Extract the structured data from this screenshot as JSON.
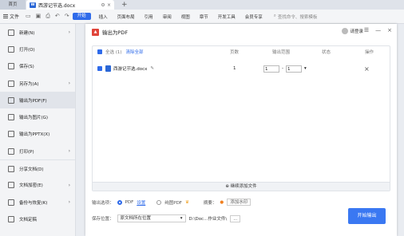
{
  "tabs": {
    "home": "首页",
    "doc_title": "西游记节选.docx",
    "doc_icon": "W"
  },
  "menu": {
    "file": "文件",
    "tabs": [
      "开始",
      "插入",
      "页面布局",
      "引用",
      "审阅",
      "视图",
      "章节",
      "开发工具",
      "会员专享"
    ],
    "search": "查找命令、搜索模板"
  },
  "sidebar": {
    "items": [
      {
        "label": "新建(N)",
        "arrow": true
      },
      {
        "label": "打开(O)",
        "arrow": false
      },
      {
        "label": "保存(S)",
        "arrow": false
      },
      {
        "label": "另存为(A)",
        "arrow": true
      },
      {
        "label": "输出为PDF(F)",
        "arrow": false,
        "active": true
      },
      {
        "label": "输出为图片(G)",
        "arrow": false
      },
      {
        "label": "输出为PPTX(X)",
        "arrow": false
      },
      {
        "label": "打印(P)",
        "arrow": true
      },
      {
        "label": "分享文档(D)",
        "arrow": false,
        "sep": true
      },
      {
        "label": "文档加密(E)",
        "arrow": true
      },
      {
        "label": "备份与恢复(K)",
        "arrow": true
      },
      {
        "label": "文档定稿",
        "arrow": false
      }
    ]
  },
  "dialog": {
    "title": "输出为PDF",
    "login": "请登录",
    "table": {
      "select_all": "全选 (1)",
      "clear": "清除全部",
      "col_pages": "页数",
      "col_range": "输出范围",
      "col_status": "状态",
      "col_action": "操作"
    },
    "file": {
      "name": "西游记节选.docx",
      "pages": "1",
      "range_from": "1",
      "range_to": "1"
    },
    "add_files": "继续添加文件",
    "output_options": "输出选项：",
    "opt_pdf": "PDF",
    "opt_settings": "设置",
    "opt_pure": "纯图PDF",
    "sort": "摘要：",
    "add_watermark": "添加水印",
    "save_location": "保存位置：",
    "save_select": "原文档所在位置",
    "save_path": "D:\\Doc...作业文件\\",
    "more": "...",
    "start": "开始输出"
  }
}
